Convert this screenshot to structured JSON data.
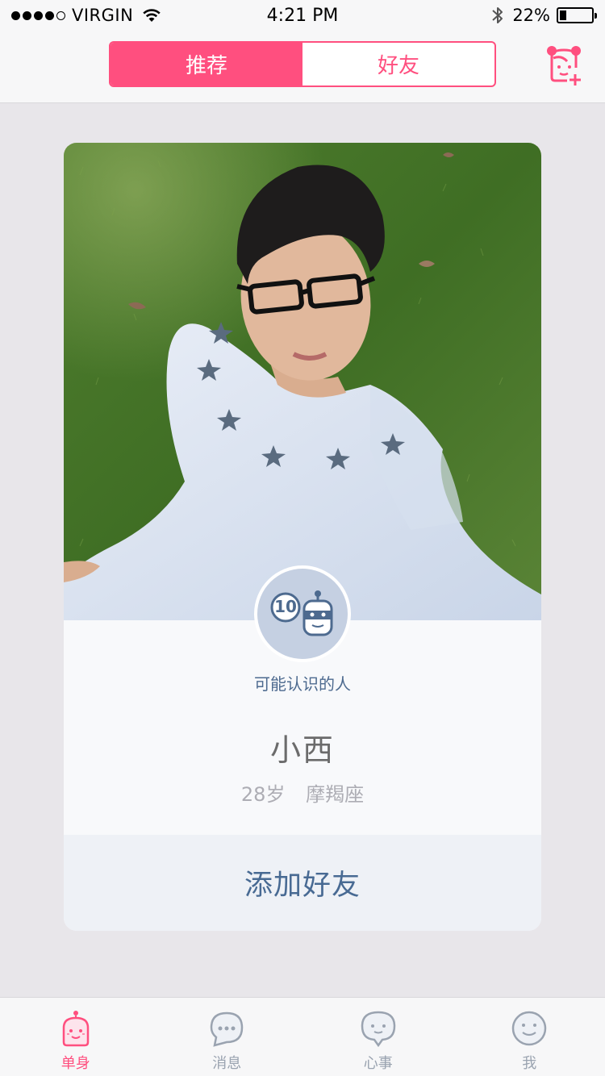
{
  "status_bar": {
    "carrier": "VIRGIN",
    "time": "4:21 PM",
    "battery_percent": "22%",
    "battery_level": 0.22,
    "signal_bars": 4
  },
  "nav": {
    "segments": [
      "推荐",
      "好友"
    ],
    "active_segment": 0,
    "add_friend_icon": "add-friend-icon"
  },
  "card": {
    "hint": "可能认识的人",
    "badge_number": "10",
    "name": "小西",
    "age": "28岁",
    "zodiac": "摩羯座",
    "add_button": "添加好友"
  },
  "tabs": [
    {
      "label": "单身",
      "icon": "single-icon",
      "active": true
    },
    {
      "label": "消息",
      "icon": "message-icon",
      "active": false
    },
    {
      "label": "心事",
      "icon": "thoughts-icon",
      "active": false
    },
    {
      "label": "我",
      "icon": "me-icon",
      "active": false
    }
  ],
  "colors": {
    "accent": "#ff4f7f",
    "primary_text": "#486a93",
    "background": "#e8e6ea"
  }
}
